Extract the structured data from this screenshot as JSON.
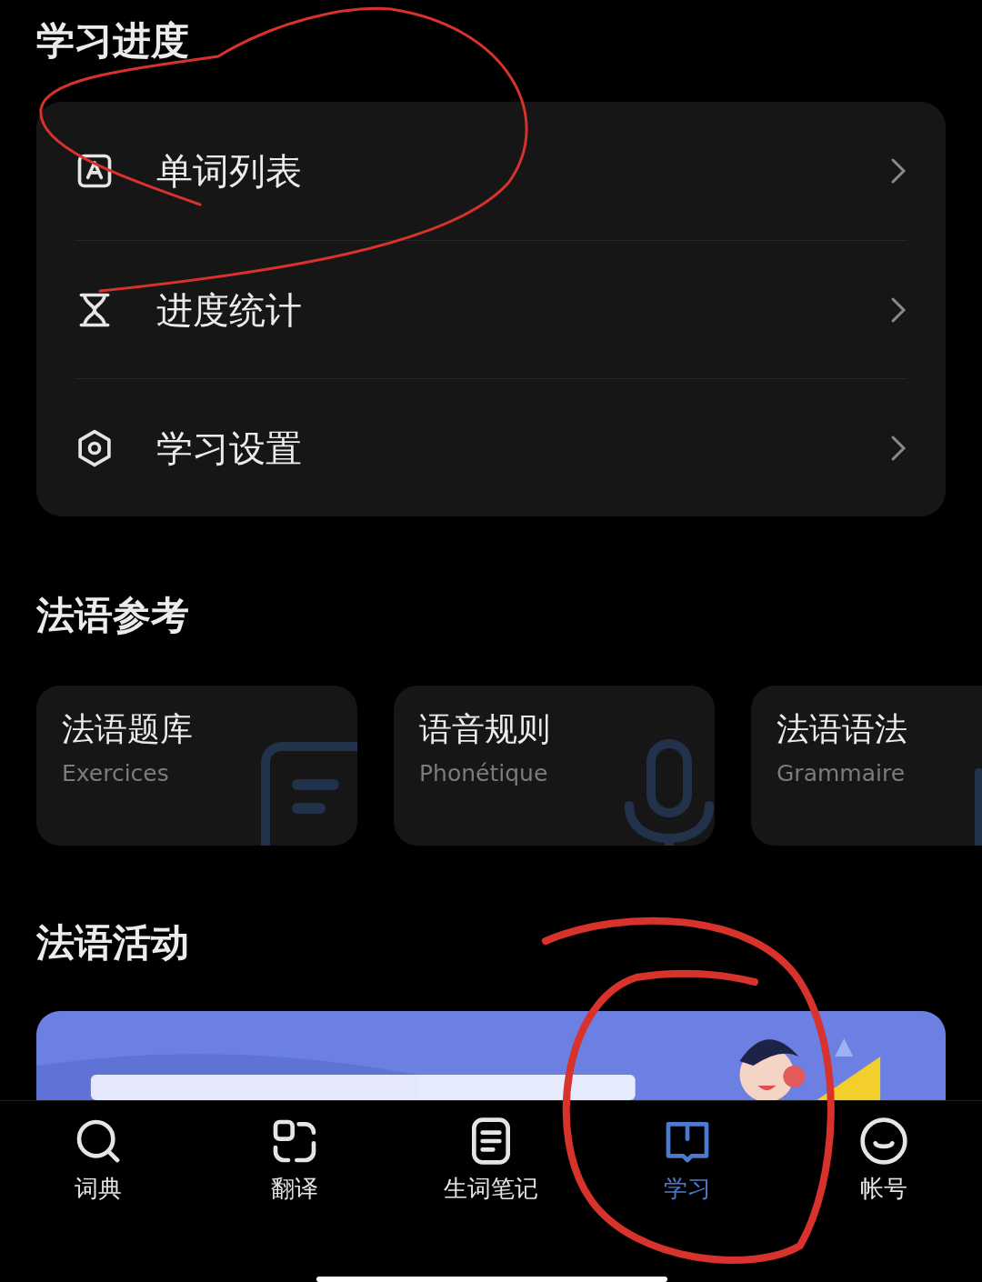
{
  "progress_section": {
    "title": "学习进度",
    "items": [
      {
        "kind": "word-list",
        "label": "单词列表"
      },
      {
        "kind": "stats",
        "label": "进度统计"
      },
      {
        "kind": "settings",
        "label": "学习设置"
      }
    ]
  },
  "reference_section": {
    "title": "法语参考",
    "cards": [
      {
        "kind": "exercises",
        "title": "法语题库",
        "subtitle": "Exercices"
      },
      {
        "kind": "phonetics",
        "title": "语音规则",
        "subtitle": "Phonétique"
      },
      {
        "kind": "grammar",
        "title": "法语语法",
        "subtitle": "Grammaire"
      }
    ]
  },
  "activity_section": {
    "title": "法语活动"
  },
  "tab_bar": [
    {
      "kind": "dictionary",
      "label": "词典",
      "selected": false
    },
    {
      "kind": "translate",
      "label": "翻译",
      "selected": false
    },
    {
      "kind": "notes",
      "label": "生词笔记",
      "selected": false
    },
    {
      "kind": "study",
      "label": "学习",
      "selected": true
    },
    {
      "kind": "account",
      "label": "帐号",
      "selected": false
    }
  ]
}
